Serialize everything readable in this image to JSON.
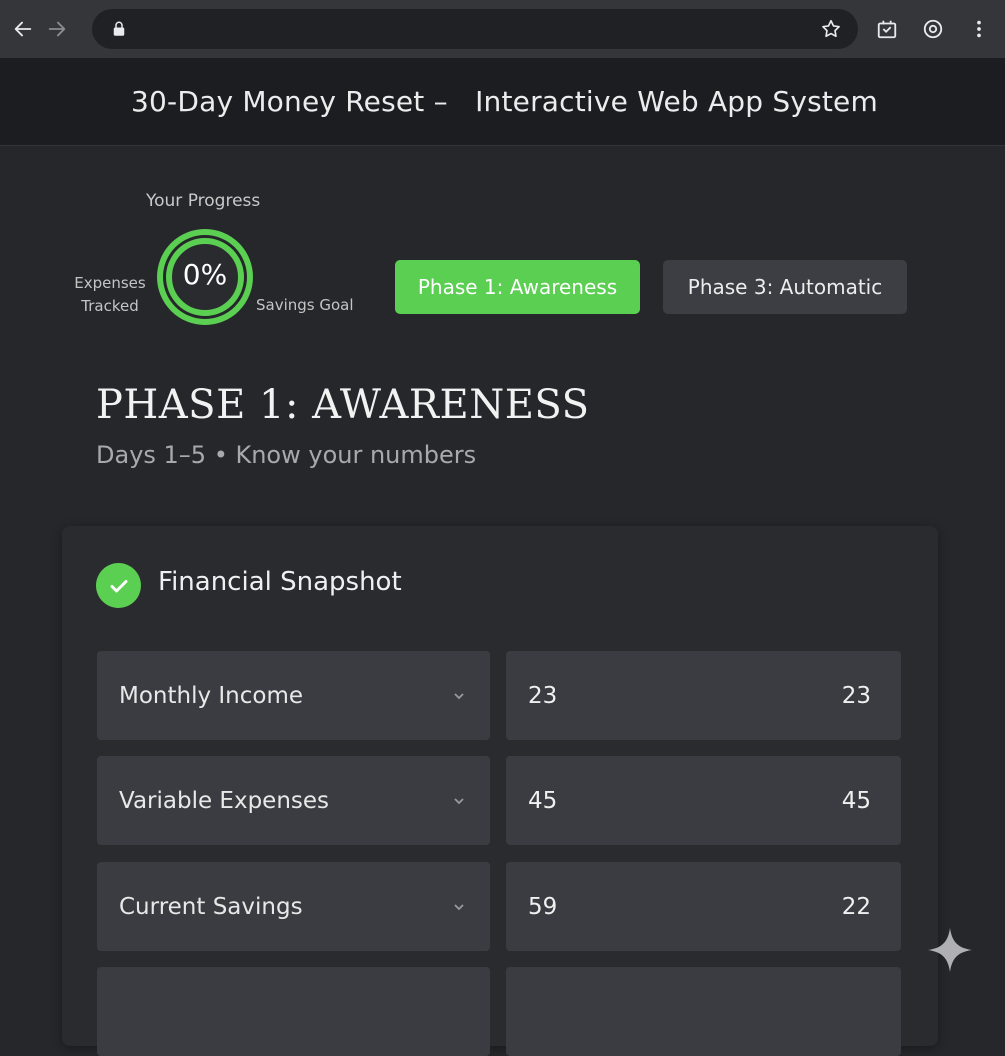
{
  "browser": {
    "url": "",
    "icons": [
      "back-arrow-icon",
      "forward-arrow-icon",
      "lock-icon",
      "star-icon",
      "download-icon",
      "account-icon",
      "more-vert-icon"
    ]
  },
  "app": {
    "title": "30-Day Money Reset –   Interactive Web App System"
  },
  "progress": {
    "label": "Your Progress",
    "value": "0%",
    "fraction": 0,
    "left_caption": "Expenses Tracked",
    "right_caption": "Savings Goal"
  },
  "phases": [
    {
      "label": "Phase 1: Awareness",
      "active": true
    },
    {
      "label": "Phase 3: Automatic",
      "active": false
    }
  ],
  "section": {
    "heading": "PHASE 1: AWARENESS",
    "subheading": "Days 1–5 • Know your numbers"
  },
  "card": {
    "title": "Financial Snapshot",
    "rows": [
      {
        "label": "Monthly Income",
        "value": "23",
        "value2": "23"
      },
      {
        "label": "Variable Expenses",
        "value": "45",
        "value2": "45"
      },
      {
        "label": "Current Savings",
        "value": "59",
        "value2": "22"
      }
    ]
  },
  "colors": {
    "accent": "#5bcf52",
    "background": "#26272b",
    "header": "#1c1d20",
    "field": "#3b3c41"
  }
}
